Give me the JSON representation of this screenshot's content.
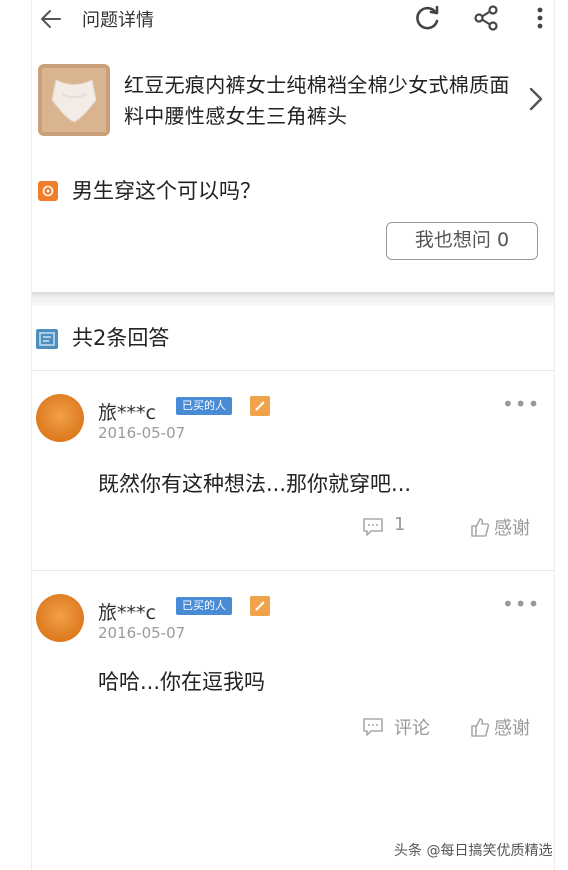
{
  "topbar": {
    "title": "问题详情",
    "icons": [
      "back-arrow-icon",
      "refresh-icon",
      "share-icon",
      "more-vertical-icon"
    ]
  },
  "product": {
    "title": "红豆无痕内裤女士纯棉裆全棉少女式棉质面料中腰性感女生三角裤头"
  },
  "question": {
    "text": "男生穿这个可以吗？",
    "ask_button": "我也想问 0"
  },
  "answers_header": "共2条回答",
  "answers": [
    {
      "username": "旅***c",
      "badge": "已买的人",
      "date": "2016-05-07",
      "content": "既然你有这种想法...那你就穿吧...",
      "comment_label": "1",
      "thanks_label": "感谢"
    },
    {
      "username": "旅***c",
      "badge": "已买的人",
      "date": "2016-05-07",
      "content": "哈哈...你在逗我吗",
      "comment_label": "评论",
      "thanks_label": "感谢"
    }
  ],
  "watermark": "头条 @每日搞笑优质精选",
  "colors": {
    "accent_orange": "#ef7d2c",
    "badge_blue": "#4a8bd6",
    "answers_icon_blue": "#4f8fc0"
  }
}
